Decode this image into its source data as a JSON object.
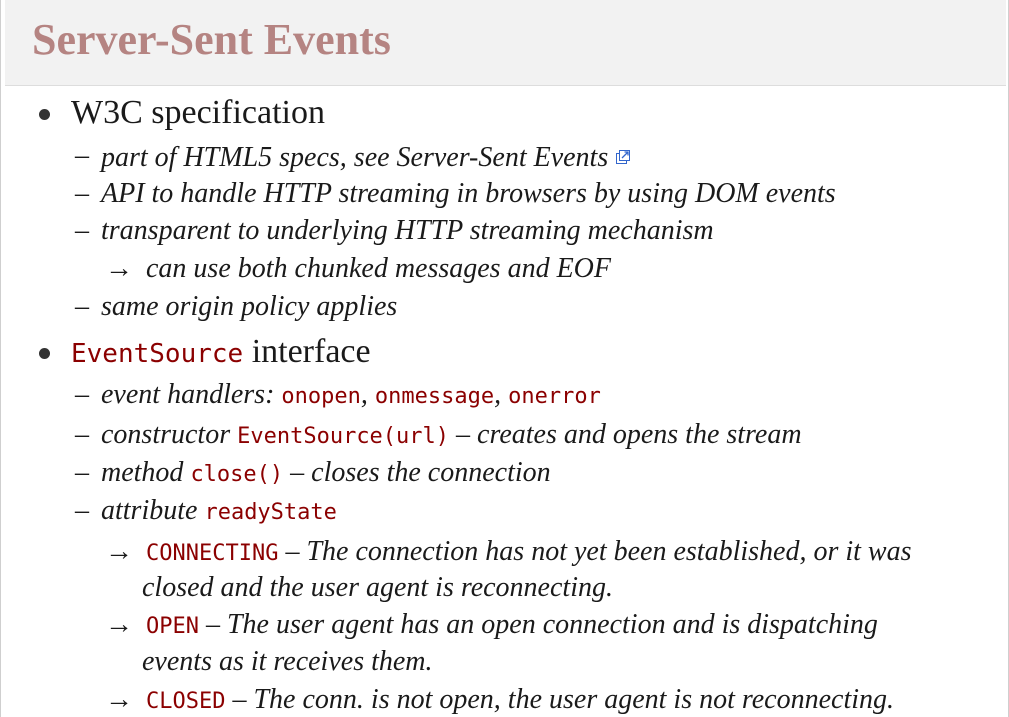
{
  "title": "Server-Sent Events",
  "bullet1": {
    "label": "W3C specification",
    "items": {
      "s1": "part of HTML5 specs, see Server-Sent Events",
      "s2": "API to handle HTTP streaming in browsers by using DOM events",
      "s3": "transparent to underlying HTTP streaming mechanism",
      "s3a": "can use both chunked messages and EOF",
      "s4": "same origin policy applies"
    },
    "link_icon": "external-link-icon"
  },
  "bullet2": {
    "code": "EventSource",
    "label": "interface",
    "handlers": {
      "text": "event handlers:",
      "h1": "onopen",
      "sep1": ",",
      "h2": "onmessage",
      "sep2": ",",
      "h3": "onerror"
    },
    "constructor": {
      "text": "constructor",
      "code": "EventSource(url)",
      "desc": "– creates and opens the stream"
    },
    "method": {
      "text": "method",
      "code": "close()",
      "desc": "– closes the connection"
    },
    "attribute": {
      "text": "attribute",
      "code": "readyState"
    },
    "states": {
      "connecting": {
        "code": "CONNECTING",
        "line1": "– The connection has not yet been established, or it was",
        "line2": "closed and the user agent is reconnecting."
      },
      "open": {
        "code": "OPEN",
        "line1": "– The user agent has an open connection and is dispatching",
        "line2": "events as it receives them."
      },
      "closed": {
        "code": "CLOSED",
        "line1": "– The conn. is not open, the user agent is not reconnecting."
      }
    }
  },
  "glyphs": {
    "dash": "–",
    "arrow": "→"
  }
}
